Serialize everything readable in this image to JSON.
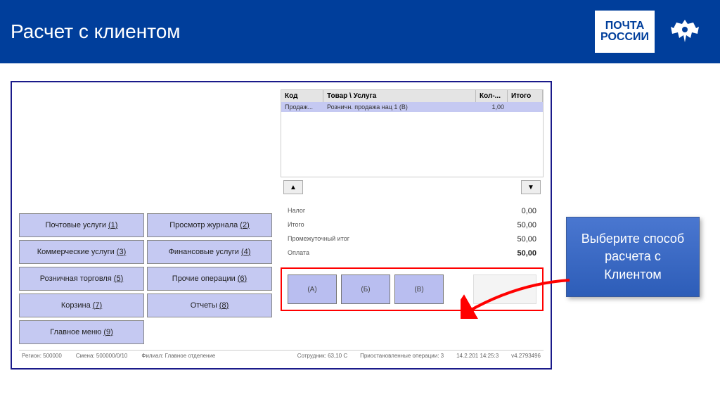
{
  "header": {
    "title": "Расчет с клиентом",
    "logo_text_1": "ПОЧТА",
    "logo_text_2": "РОССИИ"
  },
  "menu": {
    "items": [
      {
        "label": "Почтовые услуги",
        "key": "1"
      },
      {
        "label": "Просмотр журнала",
        "key": "2"
      },
      {
        "label": "Коммерческие услуги",
        "key": "3"
      },
      {
        "label": "Финансовые услуги",
        "key": "4"
      },
      {
        "label": "Розничная торговля",
        "key": "5"
      },
      {
        "label": "Прочие операции",
        "key": "6"
      },
      {
        "label": "Корзина",
        "key": "7"
      },
      {
        "label": "Отчеты",
        "key": "8"
      },
      {
        "label": "Главное меню",
        "key": "9"
      }
    ]
  },
  "table": {
    "headers": {
      "code": "Код",
      "item": "Товар \\ Услуга",
      "qty": "Кол-...",
      "total": "Итого"
    },
    "row": {
      "code": "Продаж...",
      "item": "Розничн. продажа нац 1 (В)",
      "qty": "1,00",
      "total": ""
    }
  },
  "summary": {
    "rows": [
      {
        "label": "Налог",
        "value": "0,00"
      },
      {
        "label": "Итого",
        "value": "50,00"
      },
      {
        "label": "Промежуточный итог",
        "value": "50,00"
      },
      {
        "label": "Оплата",
        "value": "50,00"
      }
    ]
  },
  "payment": {
    "buttons": [
      {
        "label": "(A)"
      },
      {
        "label": "(Б)"
      },
      {
        "label": "(В)"
      }
    ]
  },
  "statusbar": {
    "left1": "Регион: 500000",
    "left2": "Смена: 500000/0/10",
    "left3": "Филиал: Главное отделение",
    "right1": "Сотрудник: 63,10 С",
    "right2": "Приостановленные операции: 3",
    "right3": "14.2.201 14:25:3",
    "right4": "v4.2793496"
  },
  "callout": {
    "text": "Выберите способ расчета с Клиентом"
  }
}
